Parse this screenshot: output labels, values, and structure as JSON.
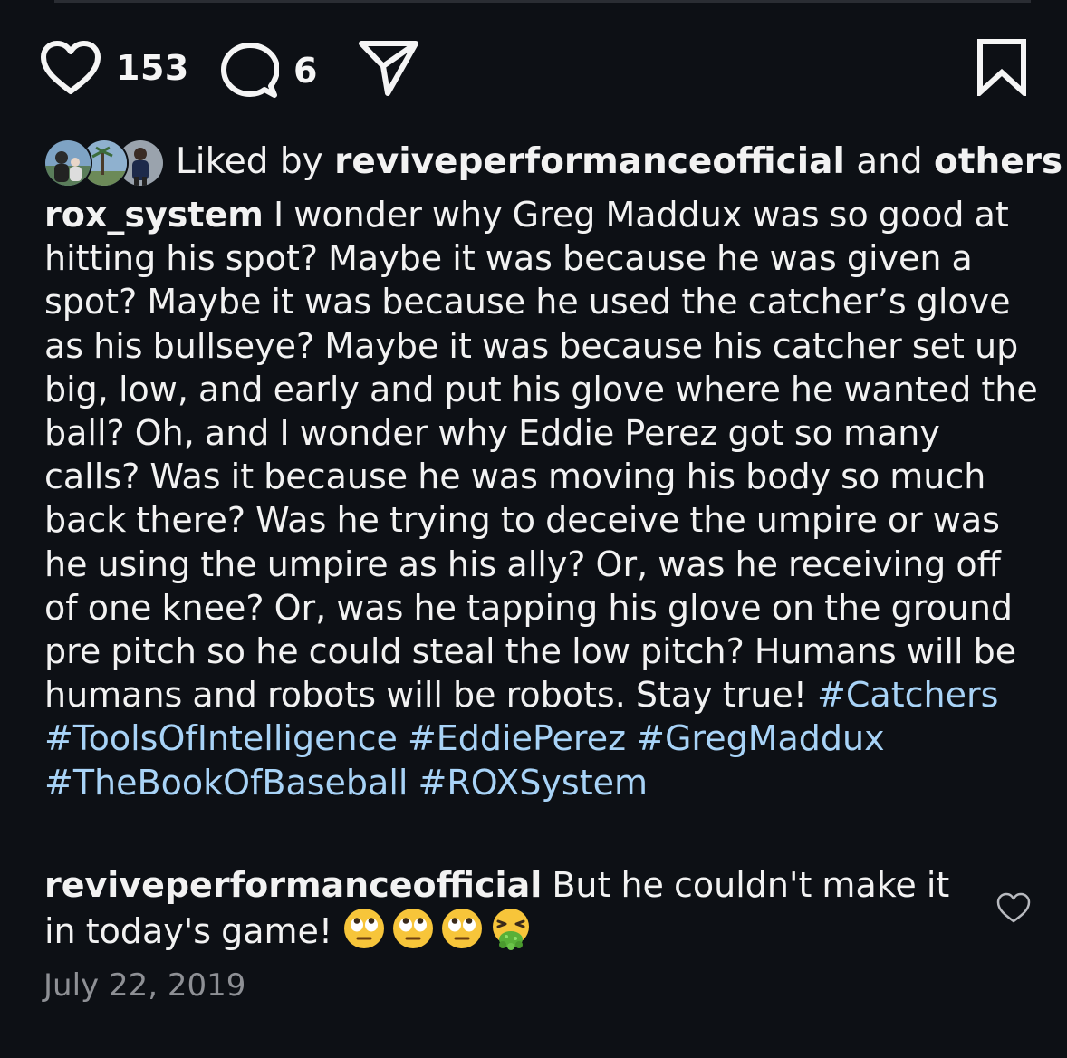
{
  "actions": {
    "like_count": "153",
    "comment_count": "6",
    "icons": [
      "heart-icon",
      "comment-icon",
      "share-icon",
      "bookmark-icon"
    ]
  },
  "likes": {
    "prefix": "Liked by",
    "user": "reviveperformanceofficial",
    "conjunction": "and",
    "others": "others"
  },
  "caption": {
    "username": "rox_system",
    "text": "I wonder why Greg Maddux was so good at hitting his spot? Maybe it was because he was given a spot? Maybe it was because he used the catcher’s glove as his bullseye? Maybe it was because his catcher set up big, low, and early and put his glove where he wanted the ball? Oh, and I wonder why Eddie Perez got so many calls? Was it because he was moving his body so much back there? Was he trying to deceive the umpire or was he using the umpire as his ally? Or, was he receiving off of one knee? Or, was he tapping his glove on the ground pre pitch so he could steal the low pitch? Humans will be humans and robots will be robots. Stay true!",
    "hashtags": [
      "#Catchers",
      "#ToolsOfIntelligence",
      "#EddiePerez",
      "#GregMaddux",
      "#TheBookOfBaseball",
      "#ROXSystem"
    ]
  },
  "comment": {
    "username": "reviveperformanceofficial",
    "text": "But he couldn't make it in today's game!",
    "emojis": [
      "face-with-rolling-eyes",
      "face-with-rolling-eyes",
      "face-with-rolling-eyes",
      "face-vomiting"
    ]
  },
  "date": "July 22, 2019",
  "colors": {
    "background": "#0d1015",
    "text": "#f2f2f2",
    "hashtag": "#a8d3f7",
    "muted": "#8e9095"
  }
}
